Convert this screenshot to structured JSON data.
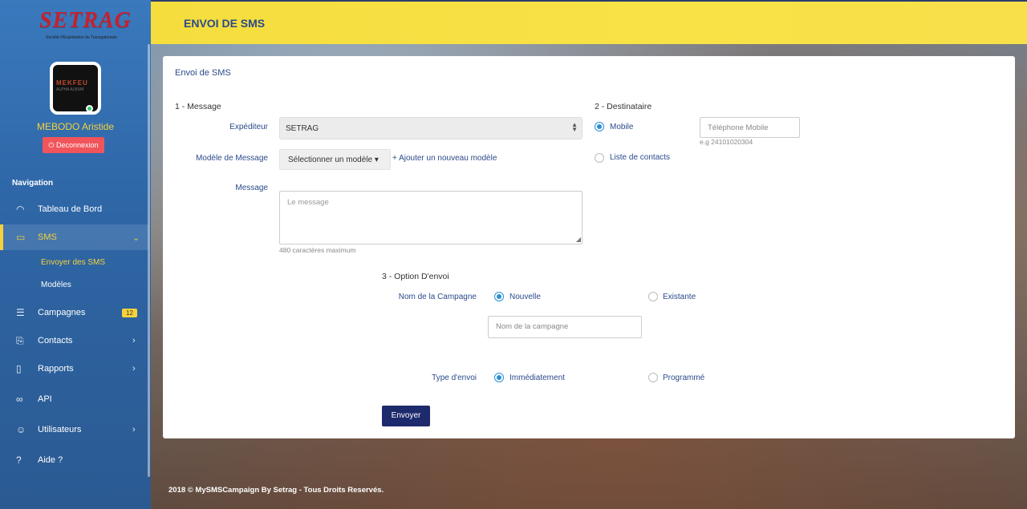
{
  "brand": {
    "name": "SETRAG",
    "tagline": "Société d'Exploitation du Transgabonais"
  },
  "avatar": {
    "text1": "MEKFEU",
    "text2": "ALPHA ALBUM"
  },
  "user": {
    "name": "MEBODO Aristide",
    "logout": "Deconnexion"
  },
  "nav": {
    "heading": "Navigation",
    "items": [
      {
        "label": "Tableau de Bord",
        "icon": "dashboard-icon"
      },
      {
        "label": "SMS",
        "icon": "message-icon"
      },
      {
        "label": "Campagnes",
        "icon": "list-icon",
        "badge": "12"
      },
      {
        "label": "Contacts",
        "icon": "bookmark-icon"
      },
      {
        "label": "Rapports",
        "icon": "book-icon"
      },
      {
        "label": "API",
        "icon": "link-icon"
      },
      {
        "label": "Utilisateurs",
        "icon": "user-icon"
      },
      {
        "label": "Aide ?",
        "icon": "help-icon"
      }
    ],
    "sms_sub": [
      "Envoyer des SMS",
      "Modèles"
    ]
  },
  "header": {
    "title": "ENVOI DE SMS"
  },
  "form": {
    "card_title": "Envoi de SMS",
    "section1": "1 - Message",
    "section2": "2 - Destinataire",
    "section3": "3 - Option D'envoi",
    "sender_label": "Expéditeur",
    "sender_value": "SETRAG",
    "template_label": "Modèle de Message",
    "template_button": "Sélectionner un modèle",
    "add_template": "+ Ajouter un nouveau modèle",
    "message_label": "Message",
    "message_placeholder": "Le message",
    "message_hint": "480 caractères maximum",
    "dest_mobile": "Mobile",
    "dest_contacts": "Liste de contacts",
    "phone_placeholder": "Téléphone Mobile",
    "phone_hint": "e.g 24101020304",
    "campaign_label": "Nom de la Campagne",
    "campaign_new": "Nouvelle",
    "campaign_existing": "Existante",
    "campaign_placeholder": "Nom de la campagne",
    "send_type_label": "Type d'envoi",
    "send_now": "Immédiatement",
    "send_scheduled": "Programmé",
    "submit": "Envoyer"
  },
  "footer": {
    "text": "2018 © MySMSCampaign By Setrag - Tous Droits Reservés."
  }
}
